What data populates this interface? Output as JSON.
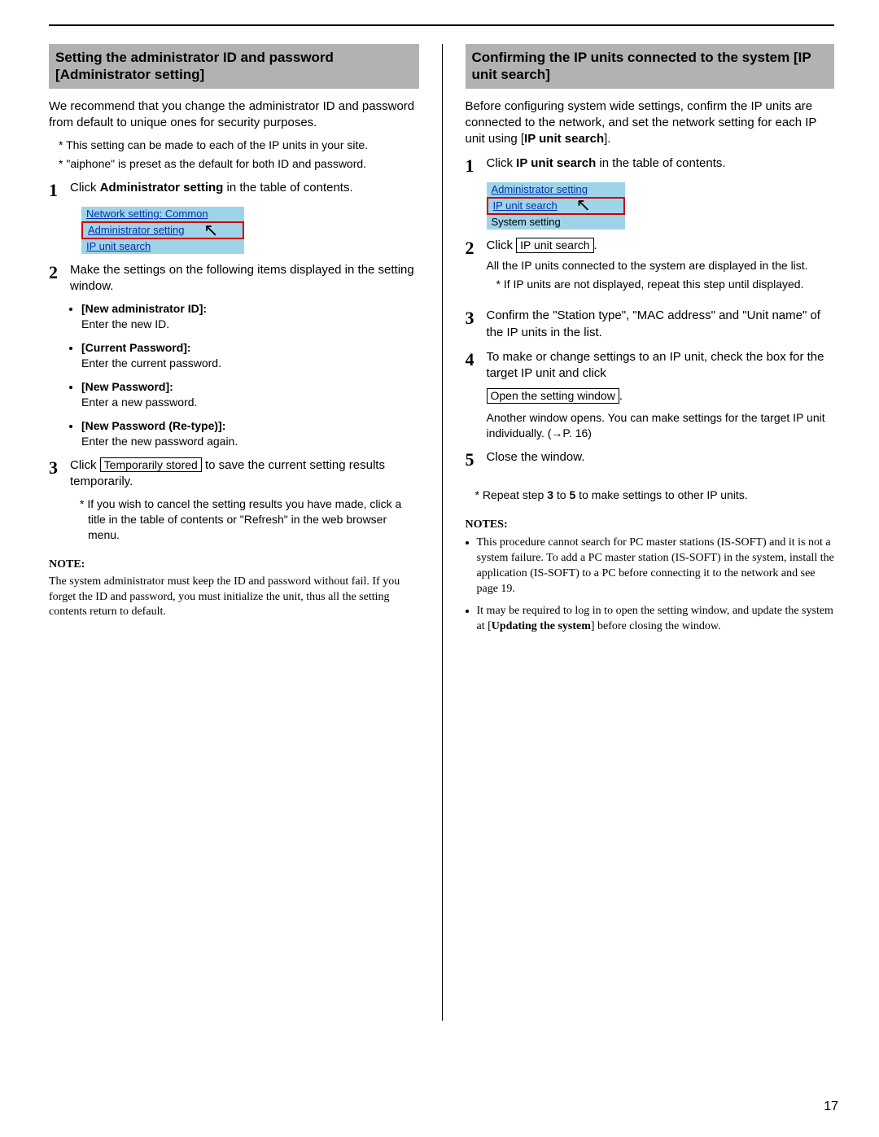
{
  "page_number": "17",
  "left": {
    "header": "Setting the administrator ID and password [Administrator setting]",
    "intro": "We recommend that you change the administrator ID and password from default to unique ones for security purposes.",
    "star_notes": [
      "This setting can be made to each of the IP units in your site.",
      "\"aiphone\" is preset as the default for both ID and password."
    ],
    "step1_pre": "Click ",
    "step1_bold": "Administrator setting",
    "step1_post": " in the table of contents.",
    "toc": {
      "line1": "Network setting: Common",
      "line2": "Administrator setting",
      "line3": "IP unit search"
    },
    "step2": "Make the settings on the following items displayed in the setting window.",
    "items": [
      {
        "label": "[New administrator ID]:",
        "desc": "Enter the new ID."
      },
      {
        "label": "[Current Password]:",
        "desc": "Enter the current password."
      },
      {
        "label": "[New Password]:",
        "desc": "Enter a new password."
      },
      {
        "label": "[New Password (Re-type)]:",
        "desc": "Enter the new password again."
      }
    ],
    "step3_pre": "Click ",
    "step3_btn": "Temporarily stored",
    "step3_post": " to save the current setting results temporarily.",
    "step3_star": "If you wish to cancel the setting results you have made, click a title in the table of contents or \"Refresh\" in the web browser menu.",
    "note_head": "NOTE:",
    "note_body": "The system administrator must keep the ID and password without fail. If you forget the ID and password, you must initialize the unit, thus all the setting contents return to default."
  },
  "right": {
    "header": "Confirming the IP units connected to the system [IP unit search]",
    "intro_pre": "Before configuring system wide settings, confirm the IP units are connected to the network, and set the network setting for each IP unit using [",
    "intro_bold": "IP unit search",
    "intro_post": "].",
    "step1_pre": "Click ",
    "step1_bold": "IP unit search",
    "step1_post": " in the table of contents.",
    "toc": {
      "line1": "Administrator setting",
      "line2": "IP unit search",
      "line3": "System setting"
    },
    "step2_pre": "Click ",
    "step2_btn": "IP unit search",
    "step2_post": ".",
    "step2_desc": "All the IP units connected to the system are displayed in the list.",
    "step2_star": "If IP units are not displayed, repeat this step until displayed.",
    "step3": "Confirm the \"Station type\", \"MAC address\" and \"Unit name\" of the IP units in the list.",
    "step4_line": "To make or change settings to an IP unit, check the box for the target IP unit and click",
    "step4_btn": "Open the setting window",
    "step4_post": ".",
    "step4_desc": "Another window opens. You can make settings for the target IP unit individually. (→P. 16)",
    "step5": "Close the window.",
    "repeat_pre": "Repeat step ",
    "repeat_b1": "3",
    "repeat_mid": " to ",
    "repeat_b2": "5",
    "repeat_post": " to make settings to other IP units.",
    "notes_head": "NOTES:",
    "note1": "This procedure cannot search for PC master stations (IS-SOFT) and it is not a system failure. To add a PC master station (IS-SOFT) in the system, install the application (IS-SOFT) to a PC before connecting it to the network and see page 19.",
    "note2_pre": "It may be required to log in to open the setting window, and update the system at [",
    "note2_bold": "Updating the system",
    "note2_post": "] before closing the window."
  }
}
